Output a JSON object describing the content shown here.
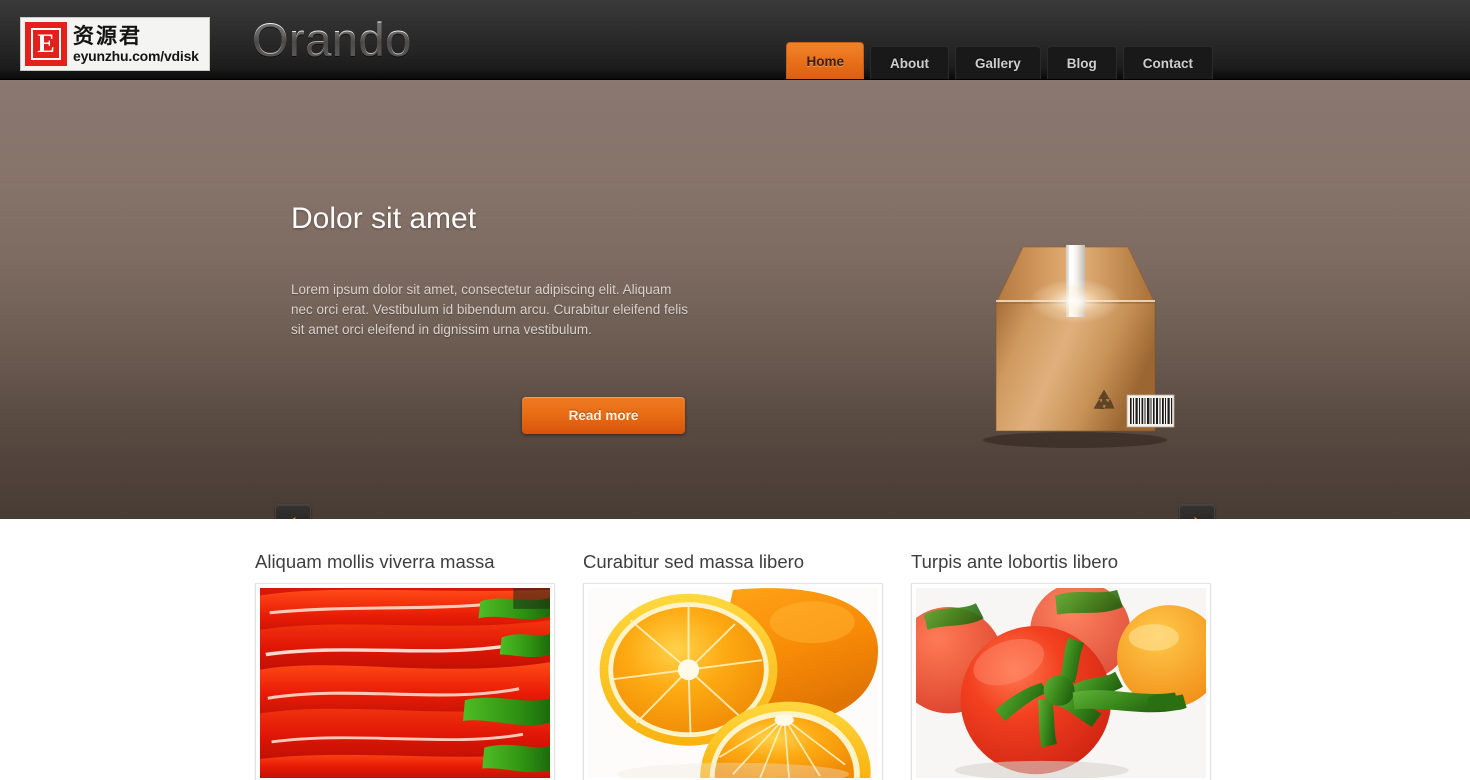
{
  "header": {
    "brand": "Orando",
    "logo": {
      "mark_letter": "E",
      "cn_text": "资源君",
      "url_text": "eyunzhu.com/vdisk"
    },
    "nav": [
      {
        "label": "Home",
        "active": true
      },
      {
        "label": "About",
        "active": false
      },
      {
        "label": "Gallery",
        "active": false
      },
      {
        "label": "Blog",
        "active": false
      },
      {
        "label": "Contact",
        "active": false
      }
    ]
  },
  "hero": {
    "title": "Dolor sit amet",
    "description": "Lorem ipsum dolor sit amet, consectetur adipiscing elit. Aliquam nec orci erat. Vestibulum id bibendum arcu. Curabitur eleifend felis sit amet orci eleifend in dignissim urna vestibulum.",
    "cta_label": "Read more",
    "prev_label": "‹",
    "next_label": "›",
    "illustration": "cardboard-box"
  },
  "content": {
    "columns": [
      {
        "title": "Aliquam mollis viverra massa",
        "image": "red-chili-peppers"
      },
      {
        "title": "Curabitur sed massa libero",
        "image": "orange-slices"
      },
      {
        "title": "Turpis ante lobortis libero",
        "image": "tomatoes-on-vine"
      }
    ]
  },
  "colors": {
    "accent": "#e8711a",
    "header_dark": "#2c2c2c",
    "hero_top": "#8a7871",
    "hero_bottom": "#483c34",
    "nav_tab": "#191919",
    "text_light": "#d9d2ce"
  }
}
